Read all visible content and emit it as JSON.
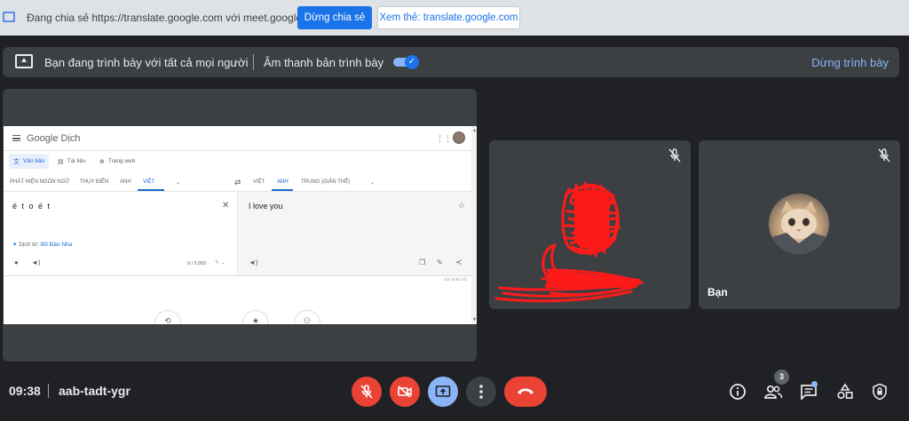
{
  "infobar": {
    "message": "Đang chia sẻ https://translate.google.com với meet.google.com",
    "stop_sharing": "Dừng chia sẻ",
    "view_tab": "Xem thẻ: translate.google.com"
  },
  "presentation_bar": {
    "presenting_text": "Bạn đang trình bày với tất cả mọi người",
    "audio_text": "Âm thanh bản trình bày",
    "stop_presenting": "Dừng trình bày",
    "audio_enabled": true
  },
  "shared_screen": {
    "logo": "Google Dịch",
    "modes": [
      "Văn bản",
      "Tài liệu",
      "Trang web"
    ],
    "source_langs": [
      "PHÁT HIỆN NGÔN NGỮ",
      "THỤY ĐIỂN",
      "ANH",
      "VIỆT"
    ],
    "target_langs": [
      "VIỆT",
      "ANH",
      "TRUNG (GIẢN THỂ)"
    ],
    "source_text": "é t o é t",
    "detected_prefix": "Dịch từ:",
    "detected_lang": "Bồ Đào Nha",
    "char_count": "9 / 5.000",
    "target_text": "I love you",
    "feedback": "Gửi phản hồi"
  },
  "participants": [
    {
      "name": "",
      "muted": true
    },
    {
      "name": "Bạn",
      "muted": true
    }
  ],
  "bottom_bar": {
    "time": "09:38",
    "meeting_code": "aab-tadt-ygr",
    "people_count": "3"
  },
  "colors": {
    "background": "#202124",
    "tile": "#3c4043",
    "danger": "#ea4335",
    "accent": "#8ab4f8",
    "infobar": "#dee1e6",
    "primary": "#1a73e8"
  }
}
